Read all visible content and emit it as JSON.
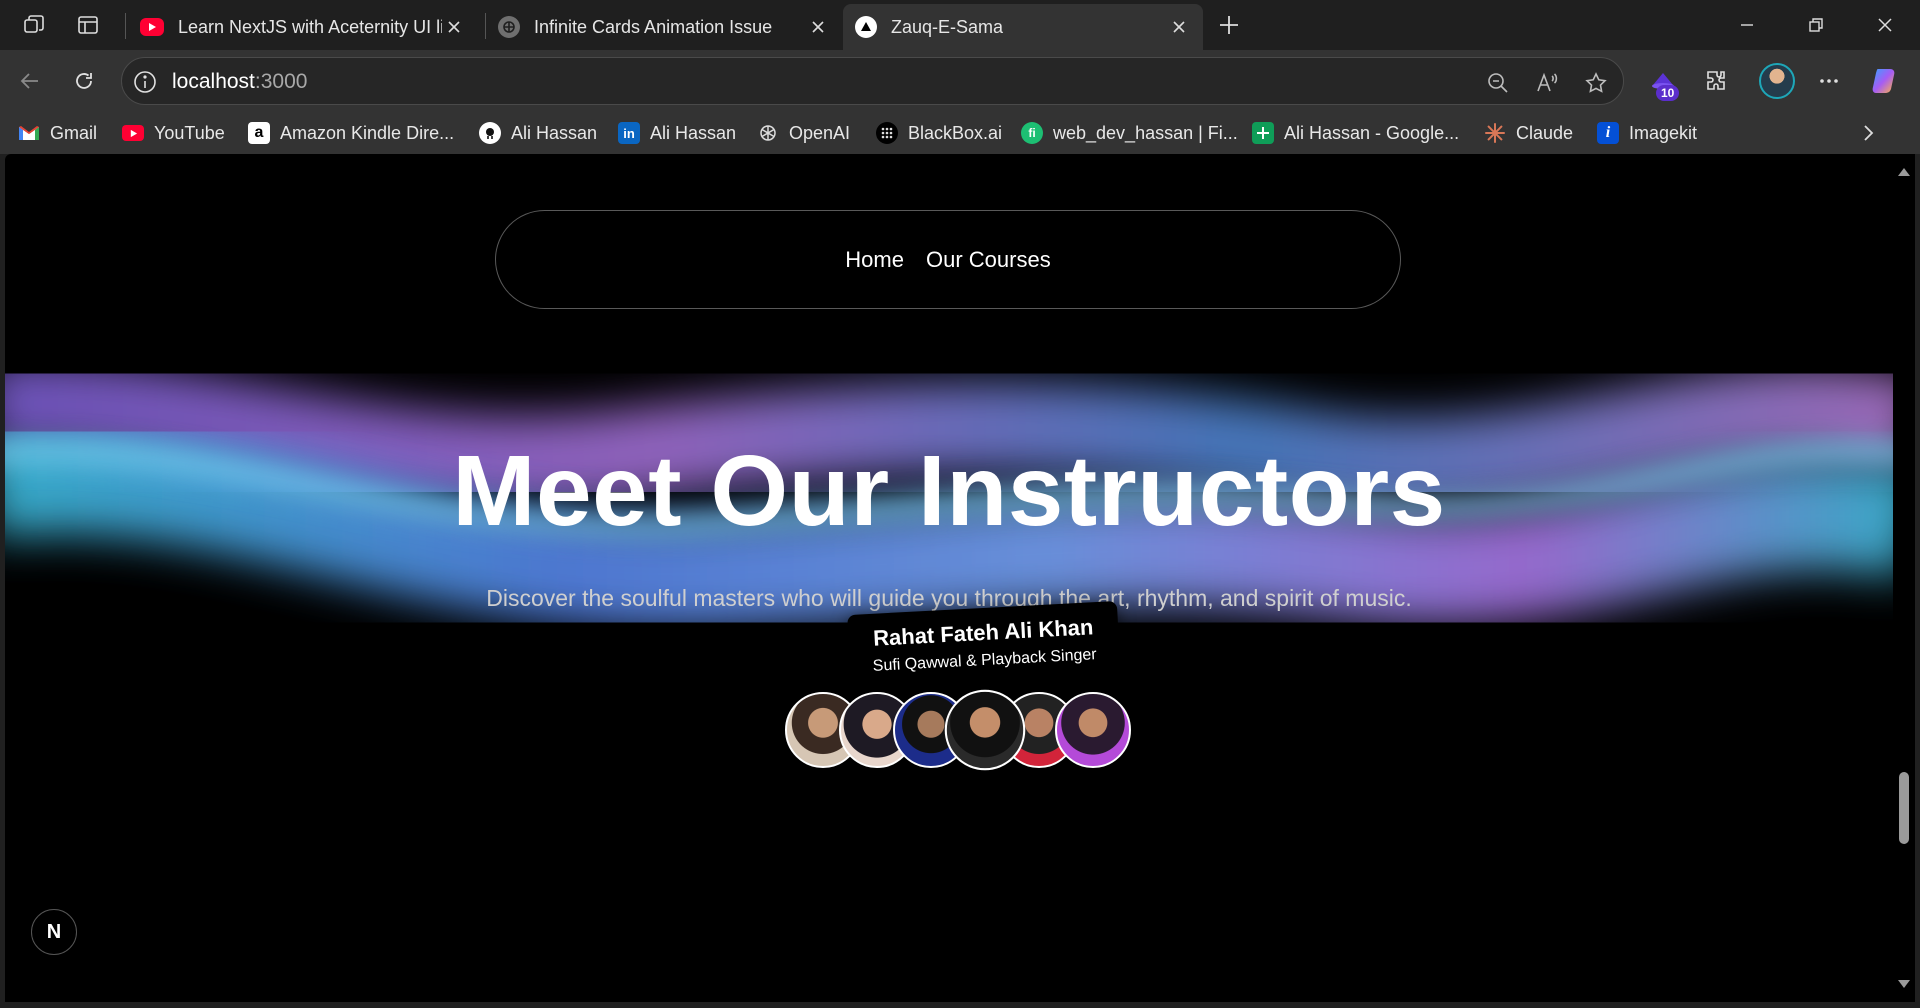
{
  "browser": {
    "tabs": [
      {
        "title": "Learn NextJS with Aceternity UI lil",
        "favicon": "youtube-icon",
        "active": false
      },
      {
        "title": "Infinite Cards Animation Issue",
        "favicon": "openai-icon",
        "active": false
      },
      {
        "title": "Zauq-E-Sama",
        "favicon": "vercel-triangle-icon",
        "active": true
      }
    ],
    "url_host": "localhost",
    "url_port": ":3000",
    "extension_badge": "10",
    "bookmarks": [
      {
        "label": "Gmail",
        "icon": "gmail-icon"
      },
      {
        "label": "YouTube",
        "icon": "youtube-icon"
      },
      {
        "label": "Amazon Kindle Dire...",
        "icon": "amazon-icon"
      },
      {
        "label": "Ali Hassan",
        "icon": "github-icon"
      },
      {
        "label": "Ali Hassan",
        "icon": "linkedin-icon"
      },
      {
        "label": "OpenAI",
        "icon": "openai-icon"
      },
      {
        "label": "BlackBox.ai",
        "icon": "blackbox-icon"
      },
      {
        "label": "web_dev_hassan | Fi...",
        "icon": "fiverr-icon"
      },
      {
        "label": "Ali Hassan - Google...",
        "icon": "google-sheets-icon"
      },
      {
        "label": "Claude",
        "icon": "claude-icon"
      },
      {
        "label": "Imagekit",
        "icon": "imagekit-icon"
      }
    ]
  },
  "page": {
    "nav": {
      "home": "Home",
      "courses": "Our Courses"
    },
    "hero": {
      "title": "Meet Our Instructors",
      "subtitle": "Discover the soulful masters who will guide you through the art, rhythm, and spirit of music."
    },
    "tooltip": {
      "name": "Rahat Fateh Ali Khan",
      "role": "Sufi Qawwal & Playback Singer"
    },
    "instructors_count": 6,
    "hovered_index": 3,
    "next_badge": "N",
    "colors": {
      "wave_cyan": "#3fc7e8",
      "wave_violet": "#b07bf0",
      "wave_blue": "#5b8cf5",
      "background": "#000000"
    }
  }
}
